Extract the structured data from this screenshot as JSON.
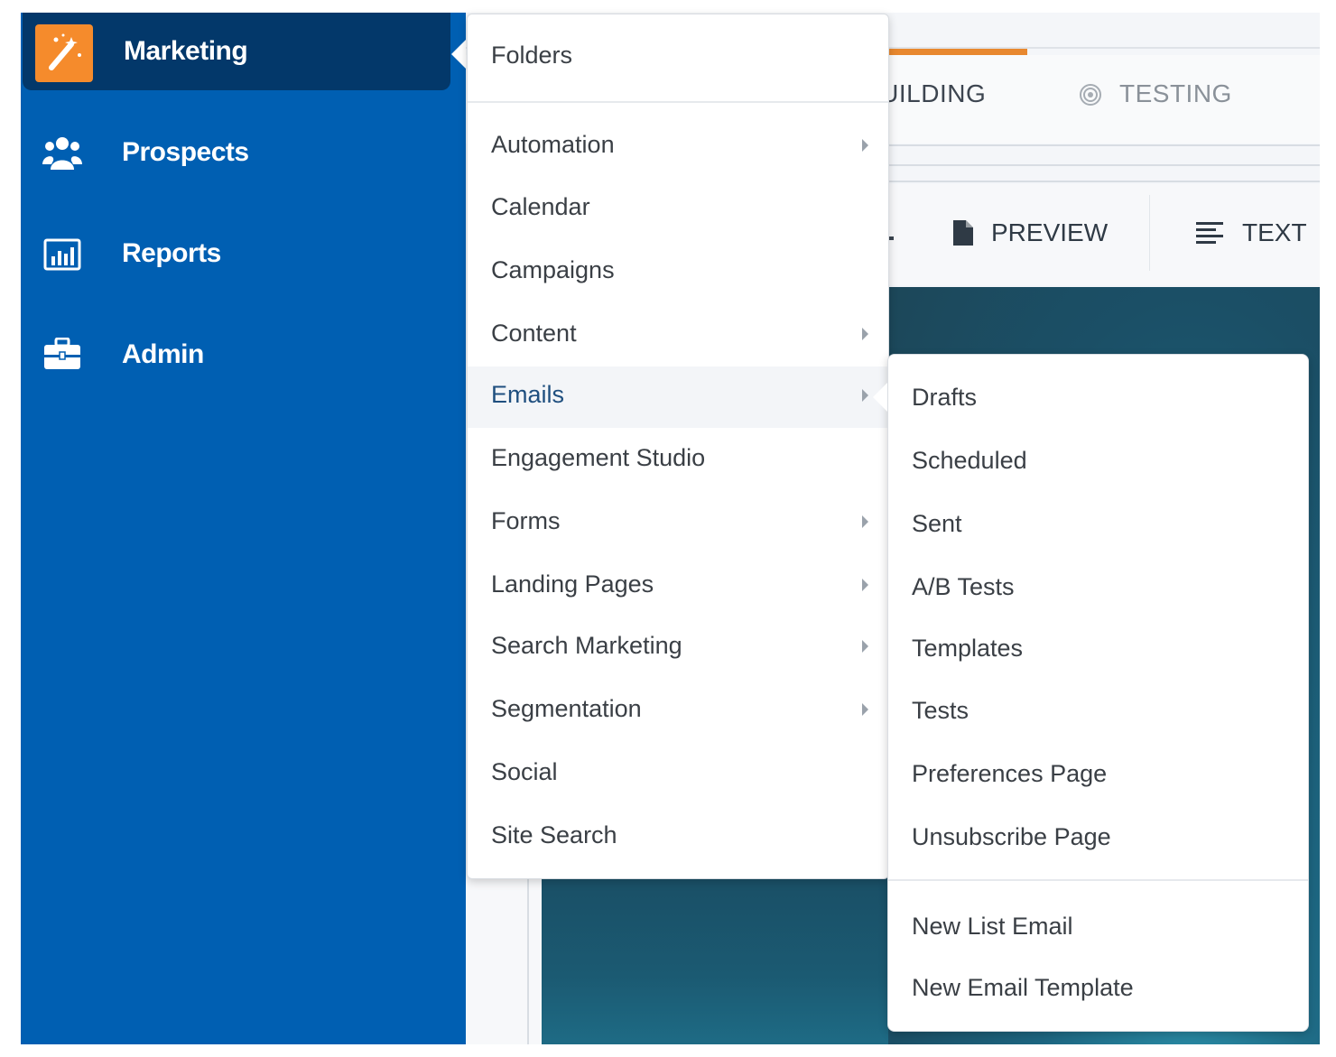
{
  "sidebar": {
    "items": [
      {
        "label": "Marketing",
        "icon": "magic-wand-icon"
      },
      {
        "label": "Prospects",
        "icon": "people-icon"
      },
      {
        "label": "Reports",
        "icon": "bar-chart-icon"
      },
      {
        "label": "Admin",
        "icon": "briefcase-icon"
      }
    ],
    "active_color": "#03386a",
    "bg_color": "#005fb2",
    "accent_color": "#f58b2c"
  },
  "menu": {
    "top_item": "Folders",
    "items": [
      {
        "label": "Automation",
        "has_submenu": true
      },
      {
        "label": "Calendar",
        "has_submenu": false
      },
      {
        "label": "Campaigns",
        "has_submenu": false
      },
      {
        "label": "Content",
        "has_submenu": true
      },
      {
        "label": "Emails",
        "has_submenu": true,
        "active": true
      },
      {
        "label": "Engagement Studio",
        "has_submenu": false
      },
      {
        "label": "Forms",
        "has_submenu": true
      },
      {
        "label": "Landing Pages",
        "has_submenu": true
      },
      {
        "label": "Search Marketing",
        "has_submenu": true
      },
      {
        "label": "Segmentation",
        "has_submenu": true
      },
      {
        "label": "Social",
        "has_submenu": false
      },
      {
        "label": "Site Search",
        "has_submenu": false
      }
    ]
  },
  "submenu": {
    "items": [
      "Drafts",
      "Scheduled",
      "Sent",
      "A/B Tests",
      "Templates",
      "Tests",
      "Preferences Page",
      "Unsubscribe Page"
    ],
    "actions": [
      "New List Email",
      "New Email Template"
    ]
  },
  "background": {
    "steps": {
      "building": "BUILDING",
      "testing": "TESTING"
    },
    "toolbar": {
      "preview": "PREVIEW",
      "text": "TEXT"
    },
    "progress_color": "#e8882f"
  }
}
